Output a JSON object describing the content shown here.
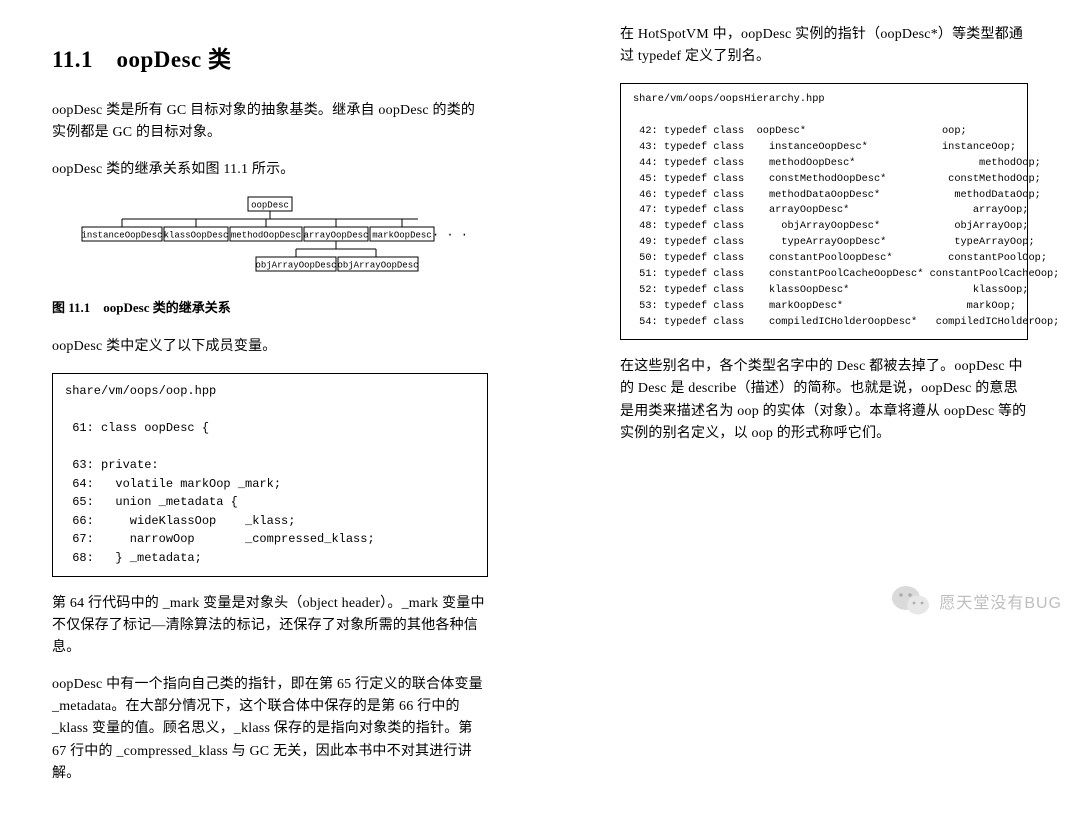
{
  "section": {
    "title": "11.1　oopDesc 类"
  },
  "col1": {
    "p1": "oopDesc 类是所有 GC 目标对象的抽象基类。继承自 oopDesc 的类的实例都是 GC 的目标对象。",
    "p2": "oopDesc 类的继承关系如图 11.1 所示。",
    "caption": "图 11.1　oopDesc 类的继承关系",
    "p3": "oopDesc 类中定义了以下成员变量。",
    "p4": "第 64 行代码中的 _mark 变量是对象头（object header）。_mark 变量中不仅保存了标记—清除算法的标记，还保存了对象所需的其他各种信息。",
    "p5": "oopDesc 中有一个指向自己类的指针，即在第 65 行定义的联合体变量 _metadata。在大部分情况下，这个联合体中保存的是第 66 行中的 _klass 变量的值。顾名思义，_klass 保存的是指向对象类的指针。第 67 行中的 _compressed_klass 与 GC 无关，因此本书中不对其进行讲解。"
  },
  "diagram": {
    "root": "oopDesc",
    "mid": [
      "instanceOopDesc",
      "klassOopDesc",
      "methodOopDesc",
      "arrayOopDesc",
      "markOopDesc"
    ],
    "ellipsis": "· · ·",
    "leaf": [
      "objArrayOopDesc",
      "objArrayOopDesc"
    ]
  },
  "code1": "share/vm/oops/oop.hpp\n\n 61: class oopDesc {\n\n 63: private:\n 64:   volatile markOop _mark;\n 65:   union _metadata {\n 66:     wideKlassOop    _klass;\n 67:     narrowOop       _compressed_klass;\n 68:   } _metadata;",
  "col2": {
    "p1": "在 HotSpotVM 中，oopDesc 实例的指针（oopDesc*）等类型都通过 typedef 定义了别名。",
    "p2": "在这些别名中，各个类型名字中的 Desc 都被去掉了。oopDesc 中的 Desc 是 describe（描述）的简称。也就是说，oopDesc 的意思是用类来描述名为 oop 的实体（对象）。本章将遵从 oopDesc 等的实例的别名定义，以 oop 的形式称呼它们。"
  },
  "code2": "share/vm/oops/oopsHierarchy.hpp\n\n 42: typedef class  oopDesc*                      oop;\n 43: typedef class    instanceOopDesc*            instanceOop;\n 44: typedef class    methodOopDesc*                    methodOop;\n 45: typedef class    constMethodOopDesc*          constMethodOop;\n 46: typedef class    methodDataOopDesc*            methodDataOop;\n 47: typedef class    arrayOopDesc*                    arrayOop;\n 48: typedef class      objArrayOopDesc*            objArrayOop;\n 49: typedef class      typeArrayOopDesc*           typeArrayOop;\n 50: typedef class    constantPoolOopDesc*         constantPoolOop;\n 51: typedef class    constantPoolCacheOopDesc* constantPoolCacheOop;\n 52: typedef class    klassOopDesc*                    klassOop;\n 53: typedef class    markOopDesc*                    markOop;\n 54: typedef class    compiledICHolderOopDesc*   compiledICHolderOop;",
  "watermark": {
    "text": "愿天堂没有BUG"
  }
}
